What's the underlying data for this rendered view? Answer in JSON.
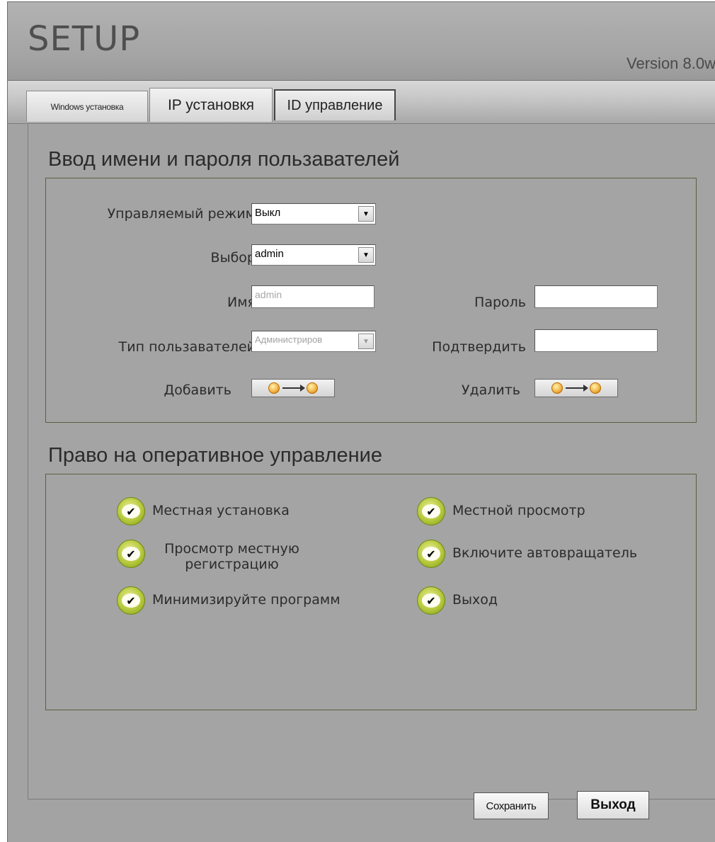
{
  "header": {
    "logo": "SETUP",
    "version": "Version 8.0w"
  },
  "tabs": [
    {
      "label": "Windows установка"
    },
    {
      "label": "IP установкя"
    },
    {
      "label": "ID управление"
    }
  ],
  "user_section": {
    "title": "Ввод имени и пароля пользавателей",
    "mode_label": "Управляемый режим",
    "mode_value": "Выкл",
    "select_label": "Выбор",
    "select_value": "admin",
    "name_label": "Имя",
    "name_value": "admin",
    "password_label": "Пароль",
    "password_value": "",
    "user_type_label": "Тип пользавателей",
    "user_type_value": "Администриров",
    "confirm_label": "Подтвердить",
    "confirm_value": "",
    "add_label": "Добавить",
    "delete_label": "Удалить"
  },
  "rights_section": {
    "title": "Право на оперативное управление",
    "items": [
      {
        "label": "Местная установка"
      },
      {
        "label": "Местной просмотр"
      },
      {
        "label": "Просмотр местную регистрацию"
      },
      {
        "label": "Включите автовращатель"
      },
      {
        "label": "Минимизируйте программ"
      },
      {
        "label": "Выход"
      }
    ]
  },
  "footer": {
    "save_label": "Сохранить",
    "exit_label": "Выход"
  }
}
